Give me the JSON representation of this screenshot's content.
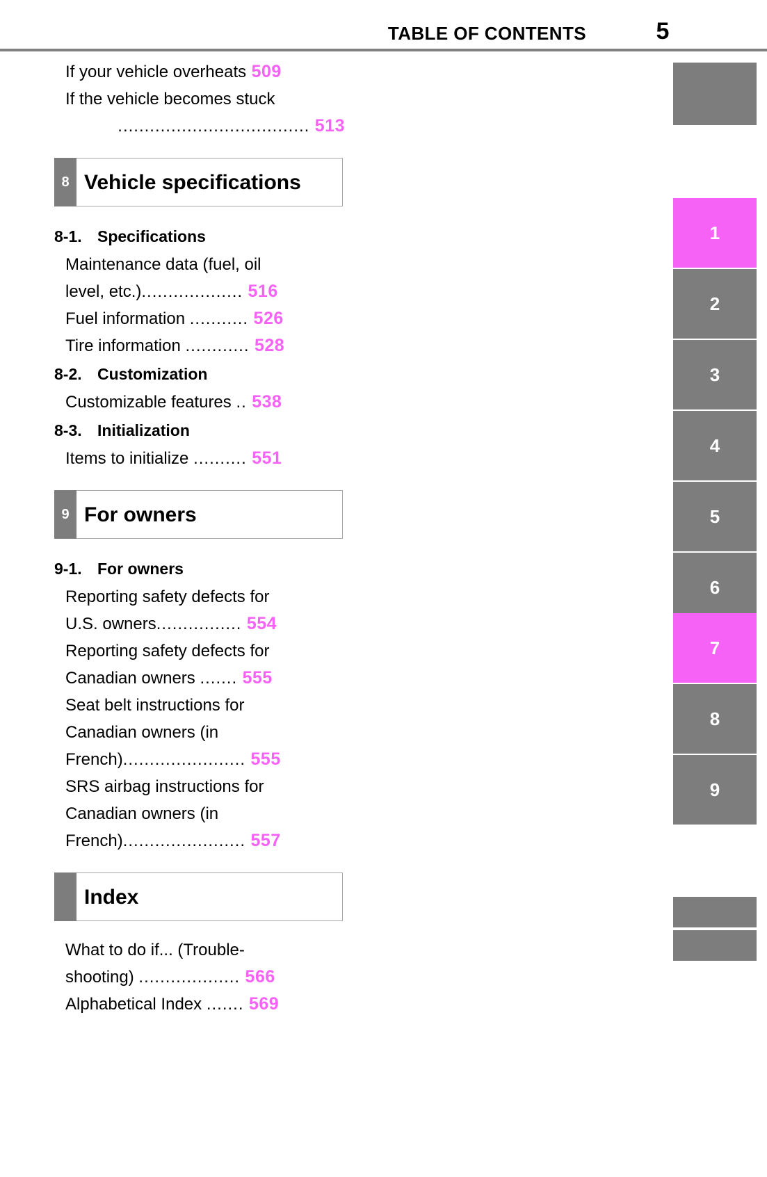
{
  "header": {
    "title": "TABLE OF CONTENTS",
    "page_number": "5"
  },
  "toc": {
    "leading_entries": [
      {
        "text": "If your vehicle overheats",
        "leaders": "",
        "page": "509"
      },
      {
        "text": "If the vehicle becomes stuck",
        "leaders": "",
        "page": ""
      },
      {
        "text": "",
        "leaders": "....................................",
        "page": "513"
      }
    ],
    "chapters": [
      {
        "number": "8",
        "title": "Vehicle specifications",
        "subsections": [
          {
            "num": "8-1.",
            "label": "Specifications",
            "entries": [
              {
                "text": "Maintenance data (fuel, oil",
                "leaders": "",
                "page": ""
              },
              {
                "text": "level, etc.)",
                "leaders": "...................",
                "page": "516"
              },
              {
                "text": "Fuel information ",
                "leaders": "...........",
                "page": "526"
              },
              {
                "text": "Tire information ",
                "leaders": "............",
                "page": "528"
              }
            ]
          },
          {
            "num": "8-2.",
            "label": "Customization",
            "entries": [
              {
                "text": "Customizable features ",
                "leaders": "..",
                "page": "538"
              }
            ]
          },
          {
            "num": "8-3.",
            "label": "Initialization",
            "entries": [
              {
                "text": "Items to initialize ",
                "leaders": "..........",
                "page": "551"
              }
            ]
          }
        ]
      },
      {
        "number": "9",
        "title": "For owners",
        "subsections": [
          {
            "num": "9-1.",
            "label": "For owners",
            "entries": [
              {
                "text": "Reporting safety defects for",
                "leaders": "",
                "page": ""
              },
              {
                "text": "U.S. owners",
                "leaders": "................",
                "page": "554"
              },
              {
                "text": "Reporting safety defects for",
                "leaders": "",
                "page": ""
              },
              {
                "text": "Canadian owners ",
                "leaders": ".......",
                "page": "555"
              },
              {
                "text": "Seat belt instructions for",
                "leaders": "",
                "page": ""
              },
              {
                "text": "Canadian owners (in",
                "leaders": "",
                "page": ""
              },
              {
                "text": "French)",
                "leaders": ".......................",
                "page": "555"
              },
              {
                "text": "SRS airbag instructions for",
                "leaders": "",
                "page": ""
              },
              {
                "text": "Canadian owners (in",
                "leaders": "",
                "page": ""
              },
              {
                "text": "French)",
                "leaders": ".......................",
                "page": "557"
              }
            ]
          }
        ]
      },
      {
        "number": "",
        "title": "Index",
        "subsections": [
          {
            "num": "",
            "label": "",
            "entries": [
              {
                "text": "What to do if... (Trouble-",
                "leaders": "",
                "page": ""
              },
              {
                "text": "shooting) ",
                "leaders": "...................",
                "page": "566"
              },
              {
                "text": "Alphabetical Index ",
                "leaders": ".......",
                "page": "569"
              }
            ]
          }
        ]
      }
    ]
  },
  "side_tabs": [
    {
      "label": "",
      "active": false
    },
    {
      "label": "1",
      "active": true
    },
    {
      "label": "2",
      "active": false
    },
    {
      "label": "3",
      "active": false
    },
    {
      "label": "4",
      "active": false
    },
    {
      "label": "5",
      "active": false
    },
    {
      "label": "6",
      "active": false
    },
    {
      "label": "7",
      "active": true
    },
    {
      "label": "8",
      "active": false
    },
    {
      "label": "9",
      "active": false
    },
    {
      "label": "",
      "active": false
    },
    {
      "label": "",
      "active": false
    }
  ],
  "colors": {
    "accent_magenta": "#F562F5",
    "tab_gray": "#7d7d7d",
    "rule_gray": "#808080"
  }
}
